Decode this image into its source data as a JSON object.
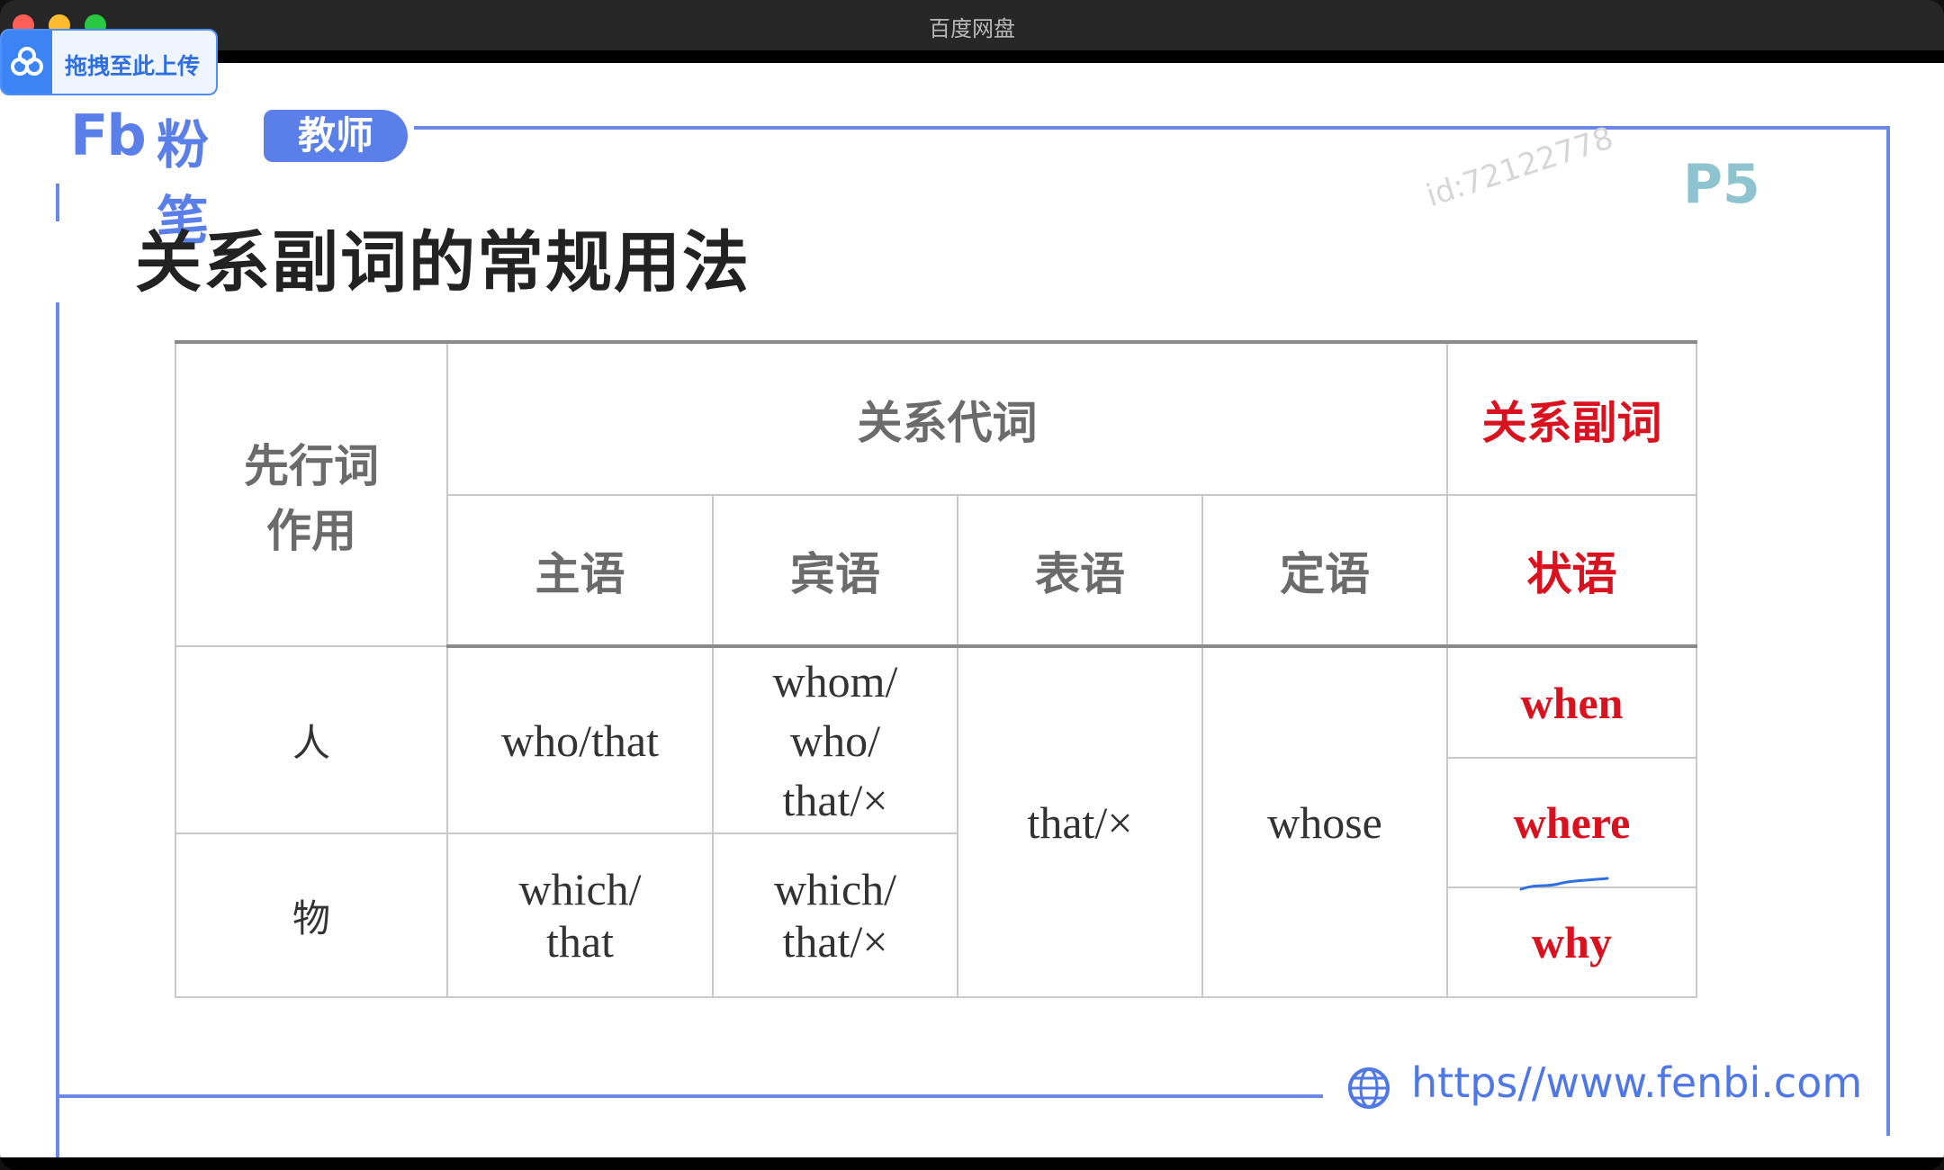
{
  "window": {
    "title": "百度网盘"
  },
  "upload": {
    "label": "拖拽至此上传"
  },
  "slide": {
    "logo_fb": "Fb",
    "logo_name": "粉笔",
    "logo_badge": "教师",
    "watermark": "id:72122778",
    "page_number": "P5",
    "heading": "关系副词的常规用法",
    "footer_url": "https//www.fenbi.com",
    "colors": {
      "frame": "#6a89e6",
      "red": "#d8121e",
      "header_gray": "#6b6b6b"
    }
  },
  "table": {
    "antecedent_header": "先行词作用",
    "pronoun_header": "关系代词",
    "adverb_header": "关系副词",
    "cols": [
      "主语",
      "宾语",
      "表语",
      "定语",
      "状语"
    ],
    "row_person": "人",
    "row_thing": "物",
    "person_subject": "who/that",
    "person_object": "whom/ who/ that/×",
    "thing_subject": "which/ that",
    "thing_object": "which/ that/×",
    "predicative": "that/×",
    "attributive": "whose",
    "adverbs": [
      "when",
      "where",
      "why"
    ]
  }
}
